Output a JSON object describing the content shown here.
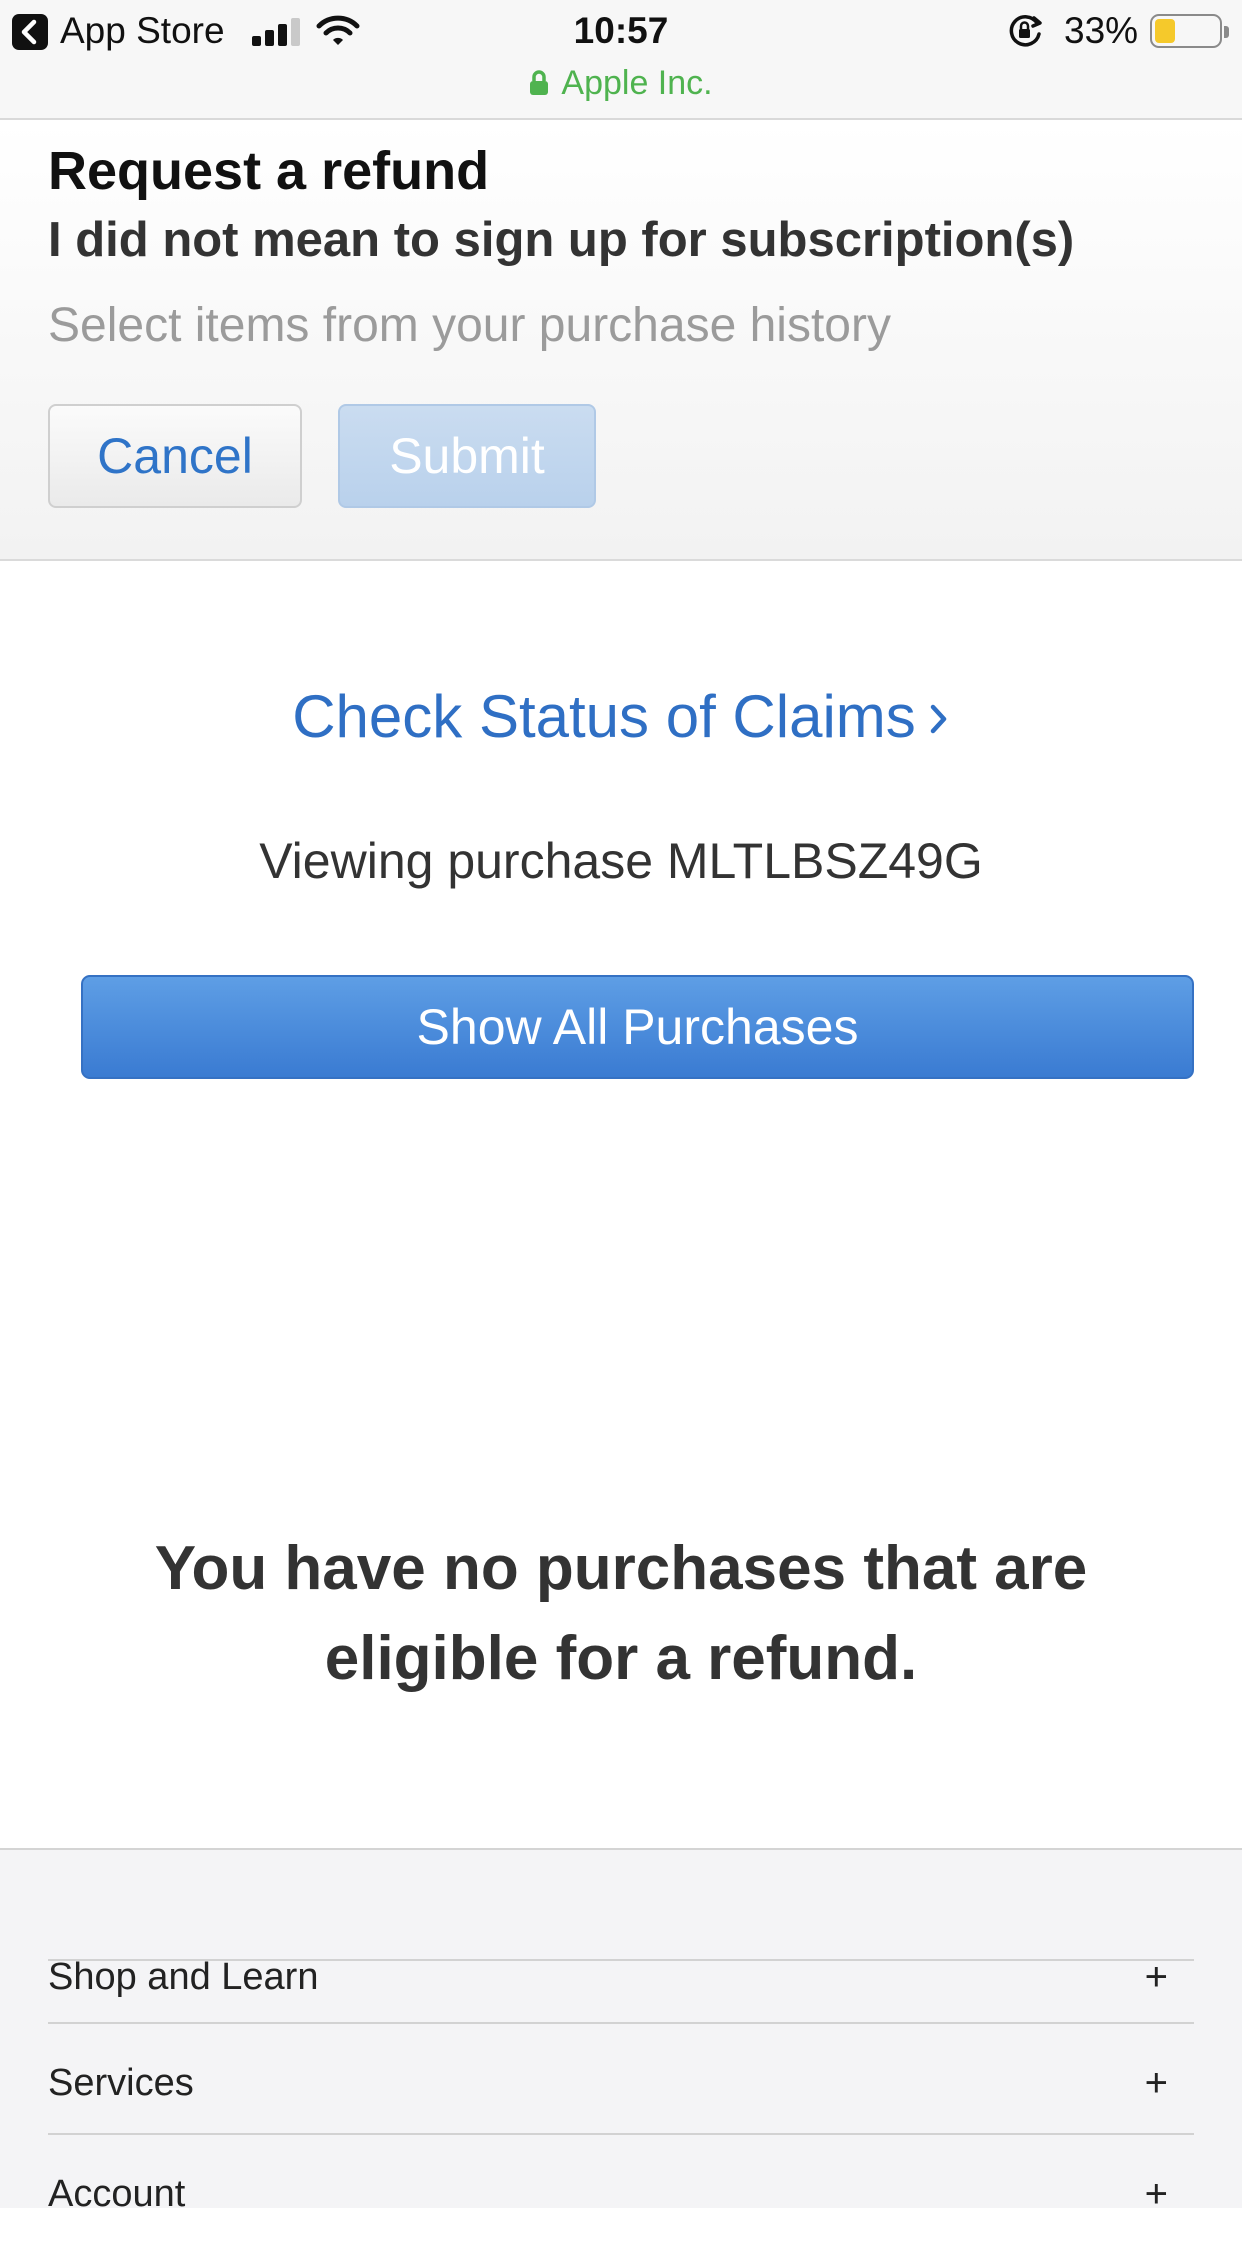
{
  "status_bar": {
    "back_app": "App Store",
    "time": "10:57",
    "battery_percent": "33%",
    "battery_level": 0.33,
    "signal_bars": 3,
    "url_host": "Apple Inc."
  },
  "refund": {
    "title": "Request a refund",
    "reason": "I did not mean to sign up for subscription(s)",
    "hint": "Select items from your purchase history",
    "cancel_label": "Cancel",
    "submit_label": "Submit"
  },
  "main": {
    "check_status_label": "Check Status of Claims",
    "viewing_purchase": "Viewing purchase MLTLBSZ49G",
    "show_all_label": "Show All Purchases",
    "no_purchases_message": "You have no purchases that are eligible for a refund."
  },
  "footer": {
    "items": [
      {
        "label": "Shop and Learn",
        "icon": "+"
      },
      {
        "label": "Services",
        "icon": "+"
      },
      {
        "label": "Account",
        "icon": "+"
      }
    ]
  },
  "colors": {
    "link_blue": "#2f6fc4",
    "secure_green": "#4fb34f",
    "battery_yellow": "#f5c92b",
    "primary_button": "#3a7bd2"
  }
}
